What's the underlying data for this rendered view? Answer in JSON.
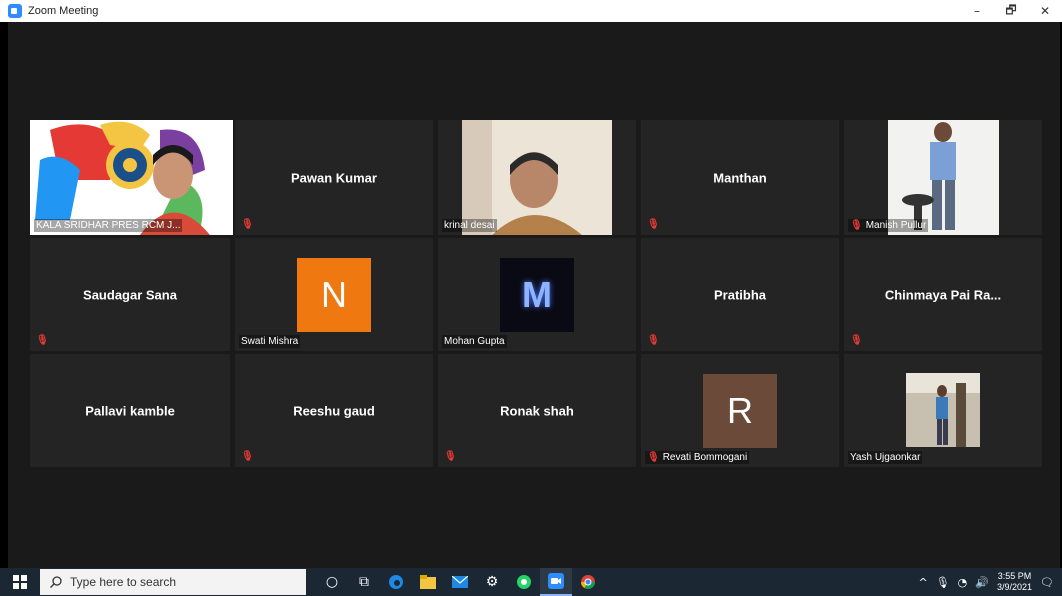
{
  "window": {
    "title": "Zoom Meeting",
    "minimize": "–",
    "restore": "🗗",
    "close": "✕"
  },
  "participants": [
    {
      "name": "KALA SRIDHAR PRES RCM J...",
      "type": "video",
      "active": true,
      "muted": false
    },
    {
      "name": "Pawan Kumar",
      "type": "name",
      "muted": true
    },
    {
      "name": "krinal desai",
      "type": "video",
      "muted": false
    },
    {
      "name": "Manthan",
      "type": "name",
      "muted": true
    },
    {
      "name": "Manish Pullur",
      "type": "video",
      "muted": true
    },
    {
      "name": "Saudagar Sana",
      "type": "name",
      "muted": true
    },
    {
      "name": "Swati Mishra",
      "type": "avatar",
      "initial": "N",
      "color": "#f07810",
      "muted": false
    },
    {
      "name": "Mohan Gupta",
      "type": "avatar-img",
      "initial": "M",
      "muted": false
    },
    {
      "name": "Pratibha",
      "type": "name",
      "muted": true
    },
    {
      "name": "Chinmaya Pai Ra...",
      "type": "name",
      "muted": true
    },
    {
      "name": "Pallavi kamble",
      "type": "name",
      "muted": false
    },
    {
      "name": "Reeshu gaud",
      "type": "name",
      "muted": true
    },
    {
      "name": "Ronak shah",
      "type": "name",
      "muted": true
    },
    {
      "name": "Revati Bommogani",
      "type": "avatar",
      "initial": "R",
      "color": "#6b4a3a",
      "muted": true
    },
    {
      "name": "Yash Ujgaonkar",
      "type": "video",
      "muted": false
    }
  ],
  "taskbar": {
    "search_placeholder": "Type here to search",
    "time": "3:55 PM",
    "date": "3/9/2021"
  },
  "colors": {
    "active_speaker": "#c8e040",
    "mute": "#e53935"
  }
}
